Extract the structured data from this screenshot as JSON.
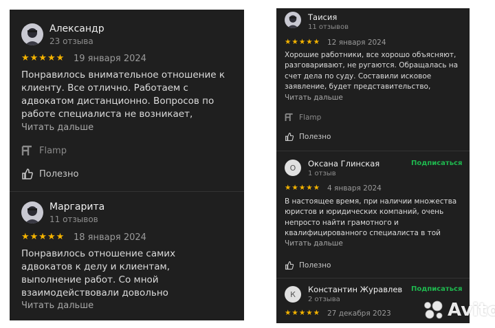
{
  "icons": {
    "avatar": "avatar-icon",
    "flamp": "flamp-logo-icon",
    "useful": "thumbs-up-icon"
  },
  "colors": {
    "panel": "#1f1f1f",
    "stars": "#f5b400",
    "subscribe": "#1fb84f",
    "page": "#ffffff"
  },
  "left": {
    "reviews": [
      {
        "name": "Александр",
        "count": "23 отзыва",
        "rating": 5,
        "stars": "★★★★★",
        "date": "19 января 2024",
        "text": "Понравилось внимательное отношение к клиенту. Все отлично. Работаем с адвокатом дистанционно. Вопросов по работе специалиста не возникает, никаких отрицате…",
        "more": "Читать дальше",
        "source": "Flamp",
        "useful": "Полезно"
      },
      {
        "name": "Маргарита",
        "count": "11 отзывов",
        "rating": 5,
        "stars": "★★★★★",
        "date": "18 января 2024",
        "text": "Понравилось отношение самих адвокатов к делу и клиентам, выполнение работ. Со мной взаимодействовали довольно понимающе. У меня идет оспаривание завещания, также по…",
        "more": "Читать дальше"
      }
    ]
  },
  "right": {
    "reviews": [
      {
        "name": "Таисия",
        "count": "11 отзывов",
        "rating": 5,
        "stars": "★★★★★",
        "date": "12 января 2024",
        "text": "Хорошие работники, все хорошо объясняют, разговаривают, не ругаются. Обращалась на счет дела по суду. Составили исковое заявление, будет представительство, разгово…",
        "more": "Читать дальше",
        "source": "Flamp",
        "useful": "Полезно"
      },
      {
        "avatar_letter": "О",
        "name": "Оксана Глинская",
        "count": "1 отзыв",
        "subscribe": "Подписаться",
        "rating": 5,
        "stars": "★★★★★",
        "date": "4 января 2024",
        "text": "В настоящее время, при наличии множества юристов и юридических компаний, очень непросто найти грамотного и квалифицированного специалиста в той или…",
        "more": "Читать дальше",
        "useful": "Полезно"
      },
      {
        "avatar_letter": "К",
        "name": "Константин Журавлев",
        "count": "2 отзыва",
        "subscribe": "Подписаться",
        "rating": 5,
        "stars": "★★★★★",
        "date": "27 декабря 2023"
      }
    ]
  },
  "watermark": {
    "text": "Avito"
  }
}
